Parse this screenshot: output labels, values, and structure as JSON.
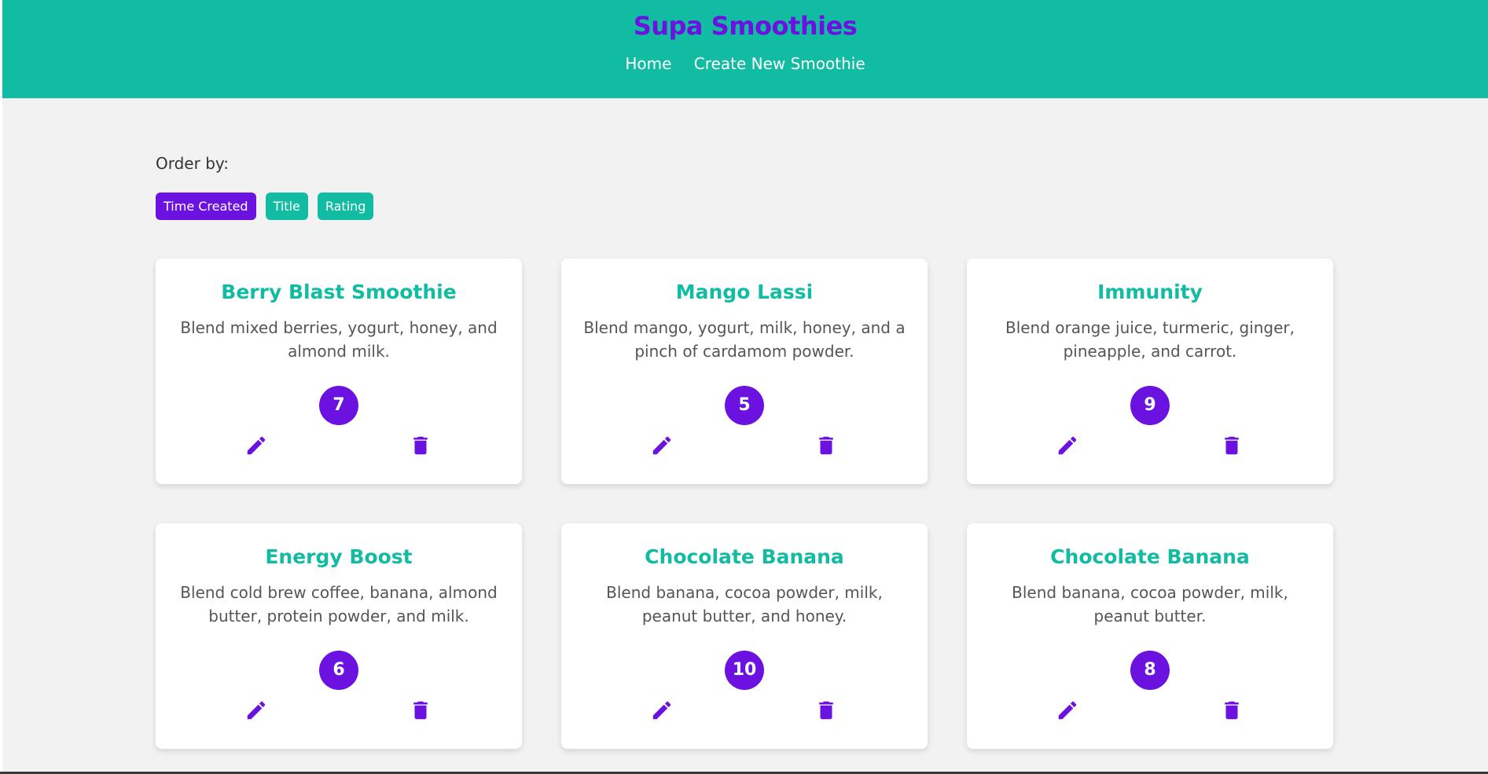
{
  "header": {
    "title": "Supa Smoothies",
    "nav": {
      "home": "Home",
      "create": "Create New Smoothie"
    }
  },
  "order": {
    "label": "Order by:",
    "options": [
      "Time Created",
      "Title",
      "Rating"
    ],
    "selected": "Time Created"
  },
  "colors": {
    "primary": "#12bca2",
    "accent": "#6c12e0",
    "background": "#f2f2f2"
  },
  "icons": {
    "edit": "pencil-icon",
    "delete": "trash-icon"
  },
  "smoothies": [
    {
      "title": "Berry Blast Smoothie",
      "method": "Blend mixed berries, yogurt, honey, and almond milk.",
      "rating": "7"
    },
    {
      "title": "Mango Lassi",
      "method": "Blend mango, yogurt, milk, honey, and a pinch of cardamom powder.",
      "rating": "5"
    },
    {
      "title": "Immunity",
      "method": "Blend orange juice, turmeric, ginger, pineapple, and carrot.",
      "rating": "9"
    },
    {
      "title": "Energy Boost",
      "method": "Blend cold brew coffee, banana, almond butter, protein powder, and milk.",
      "rating": "6"
    },
    {
      "title": "Chocolate Banana",
      "method": "Blend banana, cocoa powder, milk, peanut butter, and honey.",
      "rating": "10"
    },
    {
      "title": "Chocolate Banana",
      "method": "Blend banana, cocoa powder, milk, peanut butter.",
      "rating": "8"
    }
  ]
}
